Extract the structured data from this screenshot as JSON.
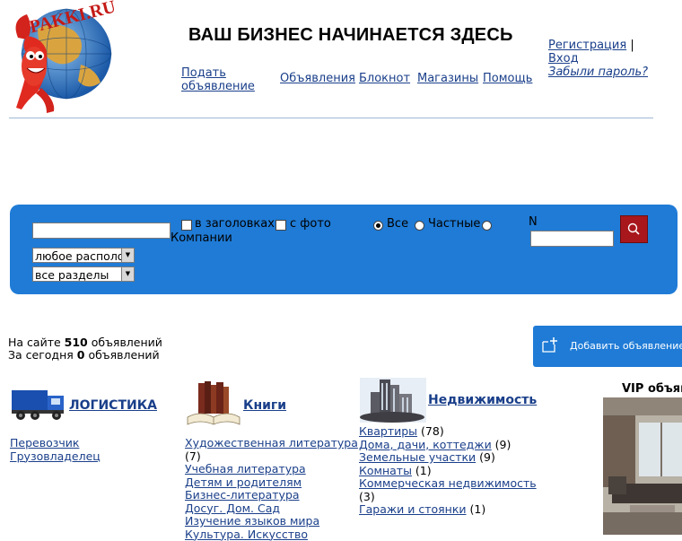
{
  "logo": {
    "text": "PAKKI.RU"
  },
  "header": {
    "tagline": "ВАШ БИЗНЕС НАЧИНАЕТСЯ ЗДЕСЬ",
    "nav": {
      "post_line1": "Подать",
      "post_line2": "объявление",
      "ads": "Объявления",
      "notepad": "Блокнот",
      "shops": "Магазины",
      "help": "Помощь"
    },
    "auth": {
      "register": "Регистрация",
      "separator": "|",
      "login": "Вход",
      "forgot": "Забыли пароль?"
    }
  },
  "search": {
    "query_value": "",
    "in_titles_label": "в заголовках",
    "with_photo_label": "с фото",
    "type_all_label": "Все",
    "type_private_label": "Частные",
    "type_company_label": "Компании",
    "number_label": "N",
    "number_value": "",
    "location_select": "любое располо",
    "section_select": "все разделы"
  },
  "stats": {
    "site_prefix": "На сайте",
    "site_count": "510",
    "site_suffix": "объявлений",
    "today_prefix": "За сегодня",
    "today_count": "0",
    "today_suffix": "объявлений"
  },
  "add_button": {
    "label": "Добавить объявление"
  },
  "categories": [
    {
      "title": "ЛОГИСТИКА",
      "items": [
        "Перевозчик",
        "Грузовладелец"
      ]
    },
    {
      "title": "Книги",
      "items": [
        "Художественная литература",
        "(7)",
        "Учебная литература",
        "Детям и родителям",
        "Бизнес-литература",
        "Досуг. Дом. Сад",
        "Изучение языков мира",
        "Культура. Искусство"
      ]
    },
    {
      "title": "Недвижимость",
      "items": [
        {
          "name": "Квартиры",
          "count": "(78)"
        },
        {
          "name": "Дома, дачи, коттеджи",
          "count": "(9)"
        },
        {
          "name": "Земельные участки",
          "count": "(9)"
        },
        {
          "name": "Комнаты",
          "count": "(1)"
        },
        {
          "name": "Коммерческая недвижимость",
          "count": ""
        },
        {
          "name": "",
          "count": "(3)"
        },
        {
          "name": "Гаражи и стоянки",
          "count": "(1)"
        }
      ]
    }
  ],
  "vip": {
    "title": "VIP объяв"
  },
  "colors": {
    "panel": "#1f7bd6",
    "link": "#1a3f8a",
    "search_button": "#a8171c"
  }
}
